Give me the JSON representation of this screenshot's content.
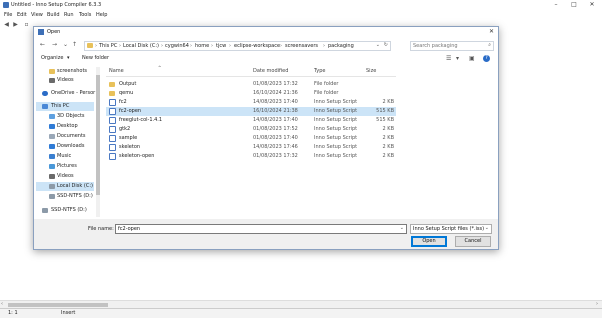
{
  "app": {
    "title": "Untitled - Inno Setup Compiler 6.3.3",
    "menu": [
      "File",
      "Edit",
      "View",
      "Build",
      "Run",
      "Tools",
      "Help"
    ],
    "status": {
      "position": "1:  1",
      "mode": "Insert"
    }
  },
  "dialog": {
    "title": "Open",
    "path": [
      "This PC",
      "Local Disk (C:)",
      "cygwin64",
      "home",
      "tjcw",
      "eclipse-workspace",
      "screensavers",
      "packaging"
    ],
    "search_placeholder": "Search packaging",
    "organize_label": "Organize",
    "new_folder_label": "New folder",
    "nav_items": [
      {
        "label": "screenshots",
        "icon": "folder-icon"
      },
      {
        "label": "Videos",
        "icon": "videos-icon"
      },
      {
        "label": "OneDrive - Persor",
        "icon": "onedrive-icon"
      },
      {
        "label": "This PC",
        "icon": "pc-icon"
      },
      {
        "label": "3D Objects",
        "icon": "objects3d-icon"
      },
      {
        "label": "Desktop",
        "icon": "desktop-icon"
      },
      {
        "label": "Documents",
        "icon": "documents-icon"
      },
      {
        "label": "Downloads",
        "icon": "downloads-icon"
      },
      {
        "label": "Music",
        "icon": "music-icon"
      },
      {
        "label": "Pictures",
        "icon": "pictures-icon"
      },
      {
        "label": "Videos",
        "icon": "videos-icon"
      },
      {
        "label": "Local Disk (C:)",
        "icon": "drive-icon"
      },
      {
        "label": "SSD-NTFS (D:)",
        "icon": "drive-icon"
      },
      {
        "label": "SSD-NTFS (D:)",
        "icon": "drive-icon"
      }
    ],
    "columns": {
      "name": "Name",
      "date": "Date modified",
      "type": "Type",
      "size": "Size"
    },
    "files": [
      {
        "name": "Output",
        "date": "01/08/2023 17:32",
        "type": "File folder",
        "size": "",
        "kind": "folder"
      },
      {
        "name": "qemu",
        "date": "16/10/2024 21:36",
        "type": "File folder",
        "size": "",
        "kind": "folder"
      },
      {
        "name": "fc2",
        "date": "14/08/2023 17:40",
        "type": "Inno Setup Script",
        "size": "2 KB",
        "kind": "iss"
      },
      {
        "name": "fc2-open",
        "date": "16/10/2024 21:38",
        "type": "Inno Setup Script",
        "size": "515 KB",
        "kind": "iss"
      },
      {
        "name": "freeglut-col-1.4.1",
        "date": "14/08/2023 17:40",
        "type": "Inno Setup Script",
        "size": "515 KB",
        "kind": "iss"
      },
      {
        "name": "gtk2",
        "date": "01/08/2023 17:52",
        "type": "Inno Setup Script",
        "size": "2 KB",
        "kind": "iss"
      },
      {
        "name": "sample",
        "date": "01/08/2023 17:40",
        "type": "Inno Setup Script",
        "size": "2 KB",
        "kind": "iss"
      },
      {
        "name": "skeleton",
        "date": "14/08/2023 17:46",
        "type": "Inno Setup Script",
        "size": "2 KB",
        "kind": "iss"
      },
      {
        "name": "skeleton-open",
        "date": "01/08/2023 17:32",
        "type": "Inno Setup Script",
        "size": "2 KB",
        "kind": "iss"
      }
    ],
    "selected_file": "fc2-open",
    "file_name_label": "File name:",
    "file_name_value": "fc2-open",
    "file_type_value": "Inno Setup Script files (*.iss)",
    "open_label": "Open",
    "cancel_label": "Cancel"
  },
  "colors": {
    "selection": "#cce4f7",
    "accent": "#0078d7",
    "folder": "#e8c15a"
  }
}
